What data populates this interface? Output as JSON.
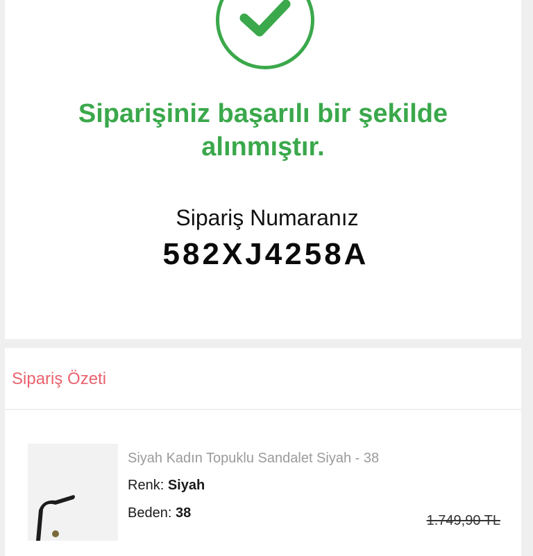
{
  "confirmation": {
    "icon": "check-circle-icon",
    "message": "Siparişiniz başarılı bir şekilde alınmıştır.",
    "order_number_label": "Sipariş Numaranız",
    "order_number": "582XJ4258A"
  },
  "summary": {
    "title": "Sipariş Özeti",
    "product": {
      "name": "Siyah Kadın Topuklu Sandalet Siyah - 38",
      "color_label": "Renk:",
      "color_value": "Siyah",
      "size_label": "Beden:",
      "size_value": "38",
      "old_price": "1.749,90 TL"
    }
  },
  "colors": {
    "success_green": "#3aa84b",
    "summary_title": "#e8626e"
  }
}
